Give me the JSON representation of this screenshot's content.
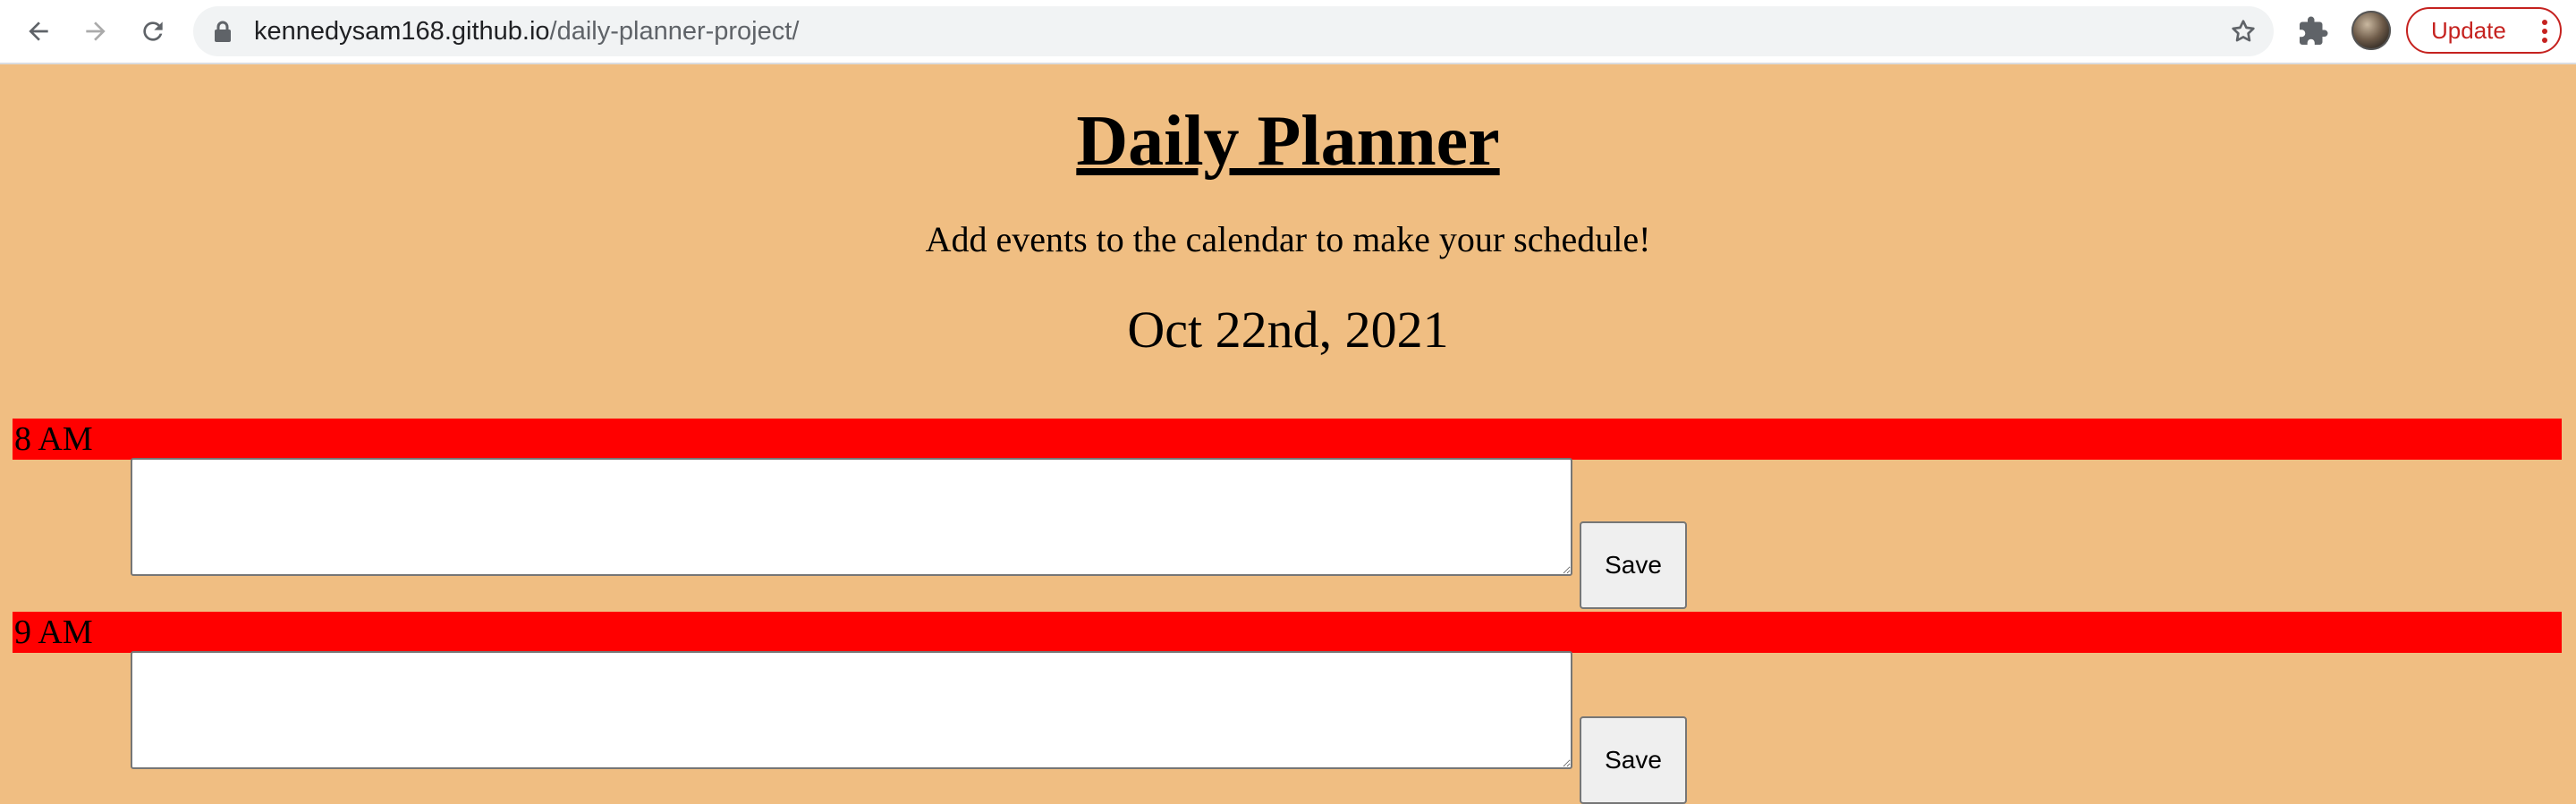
{
  "browser": {
    "url_host": "kennedysam168.github.io",
    "url_path": "/daily-planner-project/",
    "update_label": "Update",
    "icons": [
      "back-arrow-icon",
      "forward-arrow-icon",
      "reload-icon",
      "lock-icon",
      "star-icon",
      "extensions-puzzle-icon",
      "kebab-menu-icon"
    ]
  },
  "page": {
    "title": "Daily Planner",
    "lead": "Add events to the calendar to make your schedule!",
    "date": "Oct 22nd, 2021",
    "colors": {
      "background": "#f0be82",
      "hour_bar": "#ff0000"
    },
    "time_blocks": [
      {
        "hour": "8 AM",
        "value": "",
        "save_label": "Save"
      },
      {
        "hour": "9 AM",
        "value": "",
        "save_label": "Save"
      }
    ]
  }
}
